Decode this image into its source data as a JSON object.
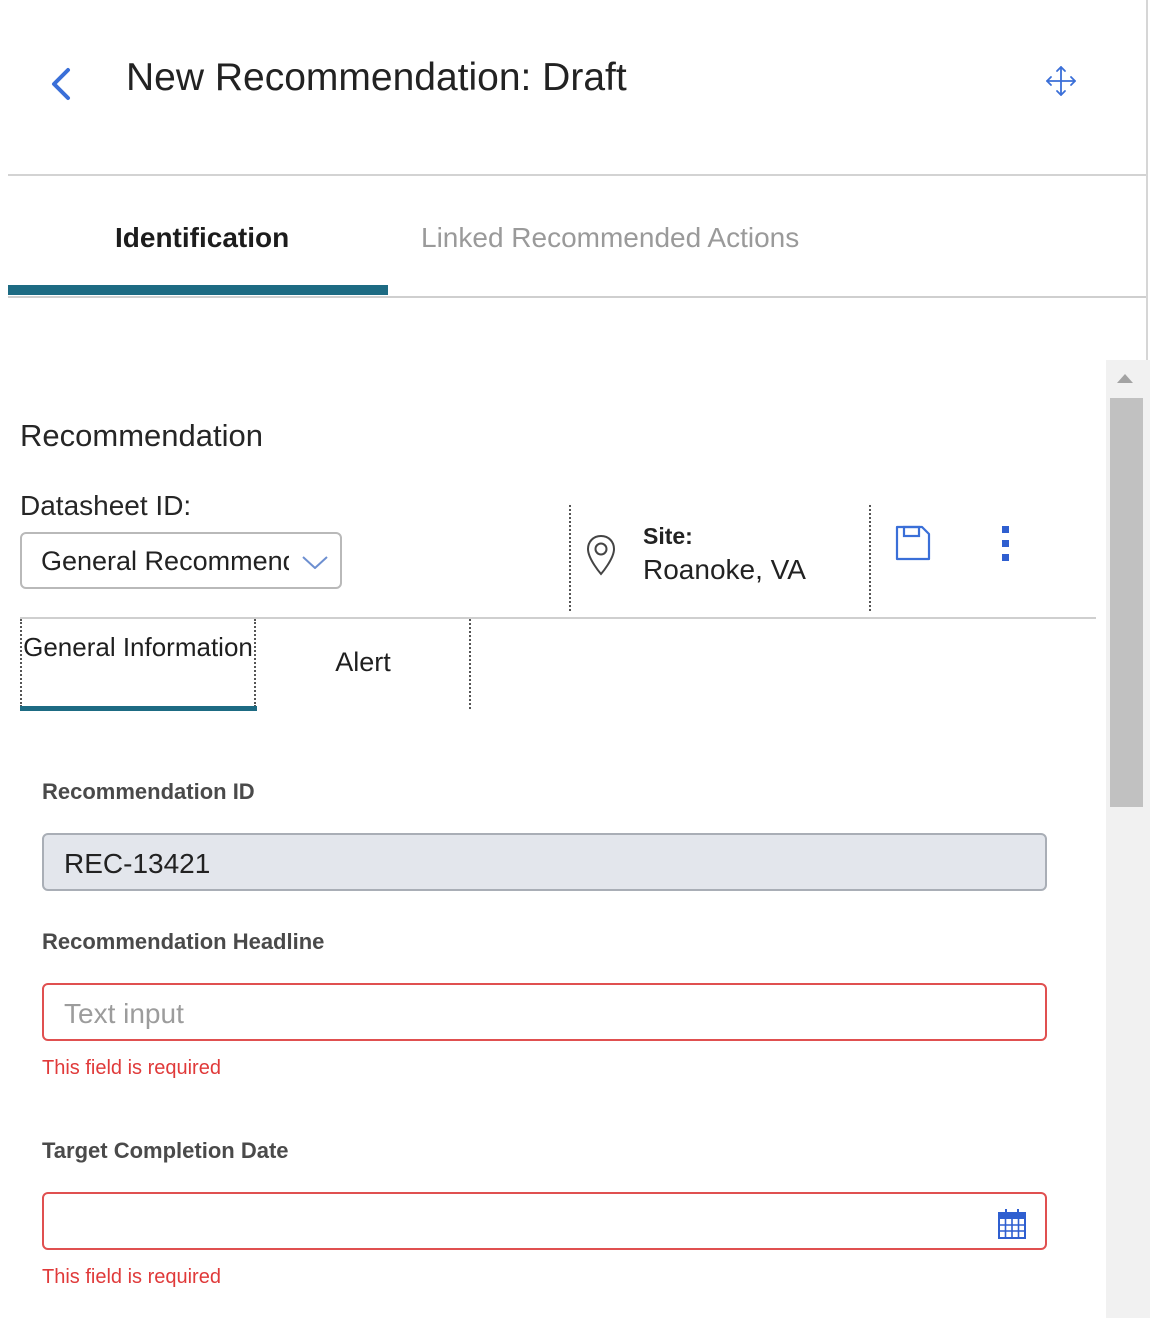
{
  "header": {
    "title": "New Recommendation: Draft"
  },
  "tabs": [
    {
      "label": "Identification",
      "active": true
    },
    {
      "label": "Linked Recommended Actions",
      "active": false
    }
  ],
  "section": {
    "title": "Recommendation",
    "datasheet_label": "Datasheet ID:",
    "datasheet_value": "General Recommendation",
    "site_label": "Site:",
    "site_value": "Roanoke, VA"
  },
  "subtabs": [
    {
      "label": "General Information",
      "active": true
    },
    {
      "label": "Alert",
      "active": false
    }
  ],
  "fields": {
    "rec_id": {
      "label": "Recommendation ID",
      "value": "REC-13421"
    },
    "headline": {
      "label": "Recommendation Headline",
      "placeholder": "Text input",
      "error": "This field is required"
    },
    "target_date": {
      "label": "Target Completion Date",
      "value": "",
      "error": "This field is required"
    }
  },
  "colors": {
    "accent": "#1d6b83",
    "link_blue": "#3a6fd8",
    "error": "#e03a3a"
  },
  "icons": [
    "back-chevron-icon",
    "move-icon",
    "location-pin-icon",
    "save-icon",
    "more-vertical-icon",
    "calendar-icon",
    "chevron-down-icon"
  ]
}
